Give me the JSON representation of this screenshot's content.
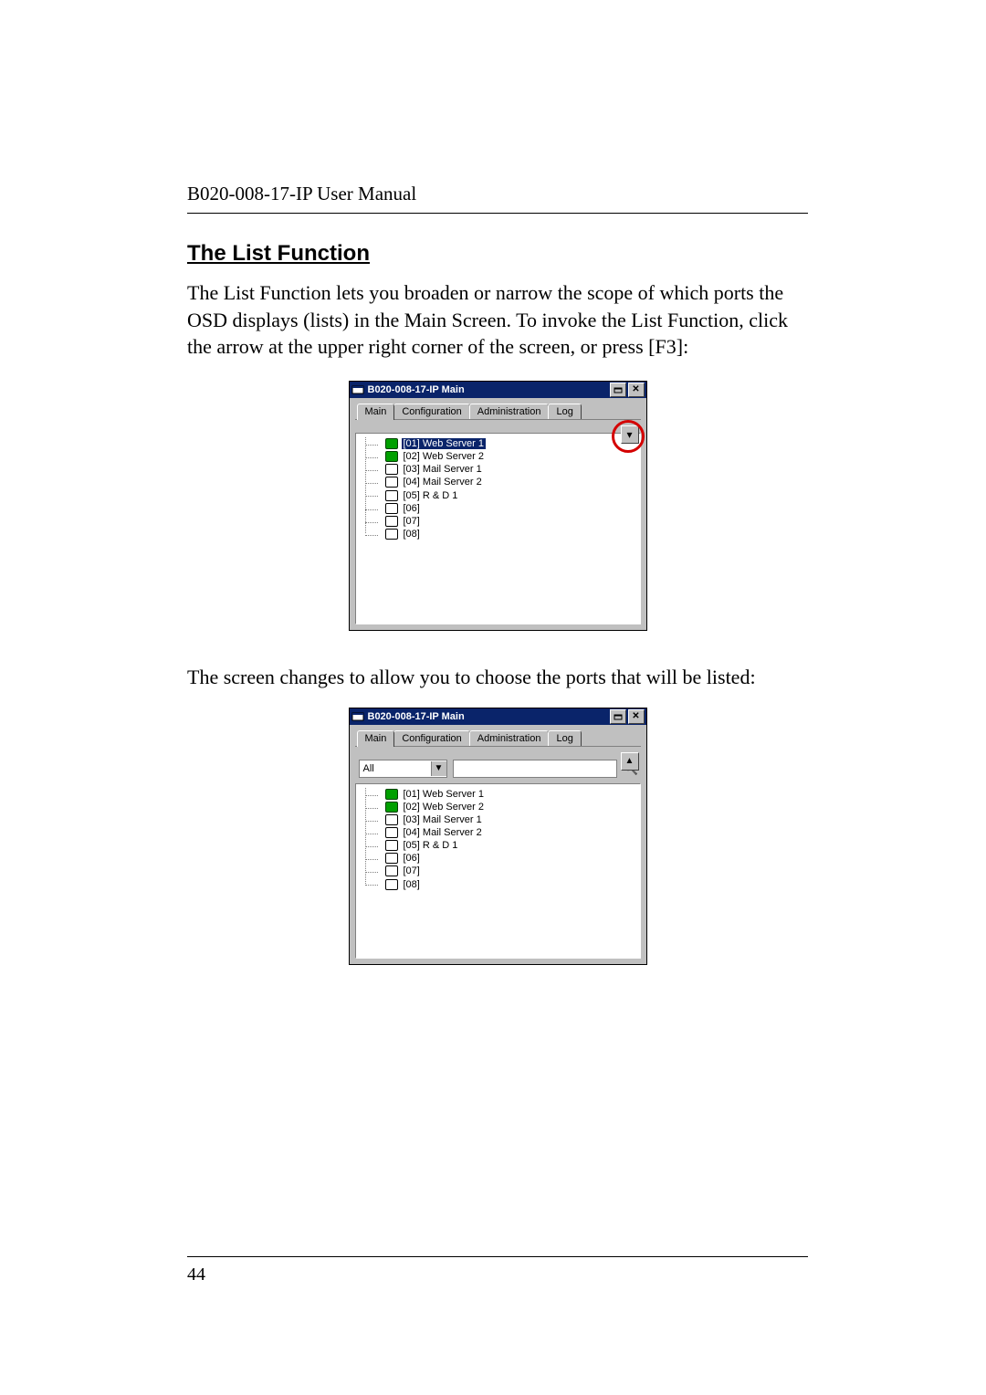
{
  "doc": {
    "running_header": "B020-008-17-IP User Manual",
    "section_title": "The List Function",
    "para1": "The List Function lets you broaden or narrow the scope of which ports the OSD displays (lists) in the Main Screen. To invoke the List Function, click the arrow at the upper right corner of the screen, or press [F3]:",
    "para2": "The screen changes to allow you to choose the ports that will be listed:",
    "page_number": "44"
  },
  "dialog": {
    "title": "B020-008-17-IP Main",
    "tabs": [
      "Main",
      "Configuration",
      "Administration",
      "Log"
    ],
    "active_tab": 0,
    "arrow_glyph": "▾",
    "filter": {
      "combo_value": "All",
      "combo_glyph": "▼",
      "search_glyph": "🔍"
    },
    "ports": [
      {
        "id": "[01]",
        "name": "Web Server 1",
        "online": true,
        "selected_in_top": true
      },
      {
        "id": "[02]",
        "name": "Web Server 2",
        "online": true
      },
      {
        "id": "[03]",
        "name": "Mail Server 1",
        "online": false
      },
      {
        "id": "[04]",
        "name": "Mail Server 2",
        "online": false
      },
      {
        "id": "[05]",
        "name": "R & D 1",
        "online": false
      },
      {
        "id": "[06]",
        "name": "",
        "online": false
      },
      {
        "id": "[07]",
        "name": "",
        "online": false
      },
      {
        "id": "[08]",
        "name": "",
        "online": false
      }
    ]
  },
  "titlebar": {
    "min_glyph": "⎵",
    "close_glyph": "✕"
  }
}
